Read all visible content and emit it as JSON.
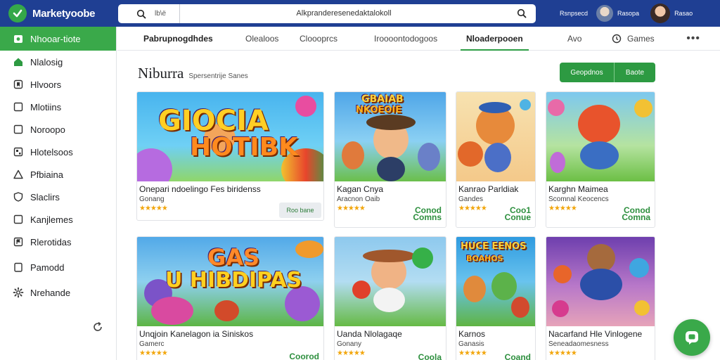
{
  "colors": {
    "topbar": "#1f3f93",
    "accent": "#3aa94a",
    "star": "#f2a60c"
  },
  "header": {
    "brand": "Marketyoobe",
    "search_scope": "lb\\ë",
    "search_query": "Alkpranderesenedaktalokoll",
    "user1_name": "Rsnpsecd",
    "user2_name": "Rasopa",
    "user3_name": "Rasao"
  },
  "sidebar": {
    "items": [
      {
        "label": "Nhooar-tiote",
        "icon": "store-icon"
      },
      {
        "label": "Nlalosig",
        "icon": "home-icon"
      },
      {
        "label": "Hlvoors",
        "icon": "bookmark-icon"
      },
      {
        "label": "Mlotiins",
        "icon": "square-icon"
      },
      {
        "label": "Noroopo",
        "icon": "square-icon"
      },
      {
        "label": "Hlotelsoos",
        "icon": "grid-icon"
      },
      {
        "label": "Pfbiaina",
        "icon": "triangle-icon"
      },
      {
        "label": "Slaclirs",
        "icon": "shield-icon"
      },
      {
        "label": "Kanjlemes",
        "icon": "square-icon"
      },
      {
        "label": "Rlerotidas",
        "icon": "flag-icon"
      },
      {
        "label": "Pamodd",
        "icon": "clipboard-icon"
      },
      {
        "label": "Nrehande",
        "icon": "gear-icon"
      }
    ]
  },
  "tabs": [
    {
      "label": "Pabrupnogdhdes"
    },
    {
      "label": "Olealoos"
    },
    {
      "label": "Cloooprcs"
    },
    {
      "label": "Iroooontodogoos"
    },
    {
      "label": "Nloaderpooen"
    },
    {
      "label": "Avo"
    },
    {
      "label": "Games"
    }
  ],
  "page": {
    "title": "Niburra",
    "subtitle": "Spersentrije Sanes",
    "btn_primary": "Geopdnos",
    "btn_secondary": "Baote"
  },
  "cards": [
    {
      "art_text_1": "GIOCIA",
      "art_text_2": "HOTIBK",
      "title": "Onepari ndoelingo Fes biridenss",
      "subtitle": "Gonang",
      "rating": "★★★★★",
      "action": "Roo bane"
    },
    {
      "art_text_1": "GBAIAB",
      "art_text_2": "NKOEOIE",
      "title": "Kagan Cnya",
      "subtitle": "Aracnon Oaib",
      "rating": "★★★★★",
      "badge_1": "Conod",
      "badge_2": "Comns"
    },
    {
      "title": "Kanrao Parldiak",
      "subtitle": "Gandes",
      "rating": "★★★★★",
      "badge_1": "Coo1",
      "badge_2": "Conue"
    },
    {
      "title": "Karghn Maimea",
      "subtitle": "Scomnal Keocencs",
      "rating": "★★★★★",
      "badge_1": "Conod",
      "badge_2": "Comna"
    },
    {
      "art_text_1": "GAS",
      "art_text_2": "U HIBDIPAS",
      "title": "Unqjoin Kanelagon ia Siniskos",
      "subtitle": "Gamerc",
      "rating": "★★★★★",
      "action": "Coorod"
    },
    {
      "title": "Uanda Nlolagaqe",
      "subtitle": "Gonany",
      "rating": "★★★★★",
      "badge_1": "Coola"
    },
    {
      "art_text_1": "HUCE EENOS",
      "art_text_2": "BOAHOS",
      "title": "Karnos",
      "subtitle": "Ganasis",
      "rating": "★★★★★",
      "badge_1": "Coand"
    },
    {
      "title": "Nacarfand Hle Vinlogene",
      "subtitle": "Seneadaomesness",
      "rating": "★★★★★"
    }
  ]
}
